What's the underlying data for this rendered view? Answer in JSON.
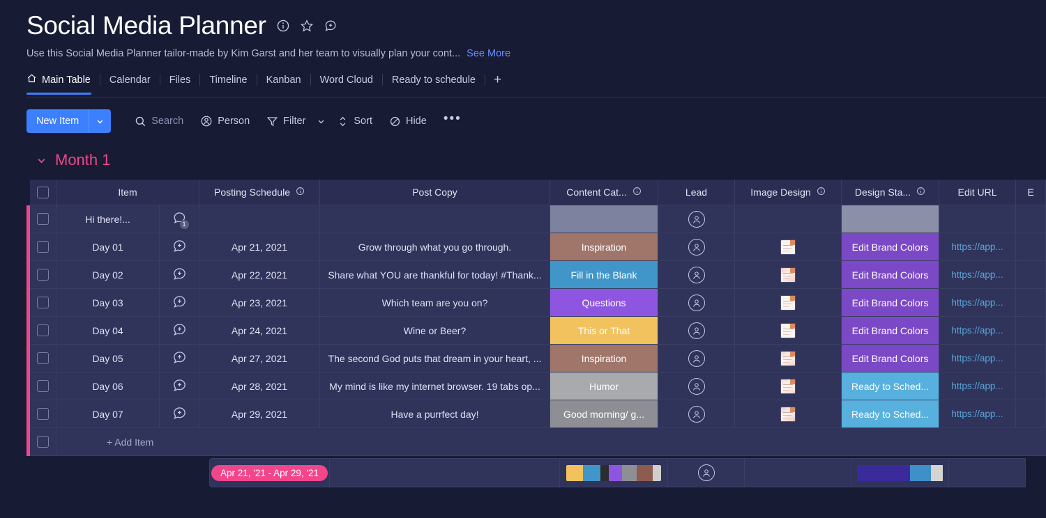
{
  "header": {
    "title": "Social Media Planner",
    "description": "Use this Social Media Planner tailor-made by Kim Garst and her team to visually plan your cont...",
    "see_more": "See More",
    "icons": [
      "info-icon",
      "star-icon",
      "add-comment-icon"
    ]
  },
  "tabs": [
    {
      "label": "Main Table",
      "icon": "home-icon",
      "active": true
    },
    {
      "label": "Calendar",
      "active": false
    },
    {
      "label": "Files",
      "active": false
    },
    {
      "label": "Timeline",
      "active": false
    },
    {
      "label": "Kanban",
      "active": false
    },
    {
      "label": "Word Cloud",
      "active": false
    },
    {
      "label": "Ready to schedule",
      "active": false
    }
  ],
  "tab_add": "+",
  "toolbar": {
    "new_item": "New Item",
    "search": "Search",
    "person": "Person",
    "filter": "Filter",
    "sort": "Sort",
    "hide": "Hide",
    "more": "•••"
  },
  "group": {
    "name": "Month 1",
    "accent": "#f2468b"
  },
  "columns": [
    {
      "label": "Item",
      "info": false
    },
    {
      "label": "Posting Schedule",
      "info": true
    },
    {
      "label": "Post Copy",
      "info": false
    },
    {
      "label": "Content Cat...",
      "info": true
    },
    {
      "label": "Lead",
      "info": false
    },
    {
      "label": "Image Design",
      "info": true
    },
    {
      "label": "Design Sta...",
      "info": true
    },
    {
      "label": "Edit URL",
      "info": false
    },
    {
      "label": "E",
      "info": false
    }
  ],
  "rows": [
    {
      "item": "Hi there!...",
      "chat": "1",
      "schedule": "",
      "copy": "",
      "category": "",
      "category_color": "#7d839e",
      "image": false,
      "status": "",
      "status_color": "#8b90a8",
      "url": ""
    },
    {
      "item": "Day 01",
      "chat": "+",
      "schedule": "Apr 21, 2021",
      "copy": "Grow through what you go through.",
      "category": "Inspiration",
      "category_color": "#a0756a",
      "image": true,
      "image_tone": "#f3efec",
      "status": "Edit Brand Colors",
      "status_color": "#7b49c6",
      "url": "https://app..."
    },
    {
      "item": "Day 02",
      "chat": "+",
      "schedule": "Apr 22, 2021",
      "copy": "Share what YOU are thankful for today! #Thank...",
      "category": "Fill in the Blank",
      "category_color": "#4096c8",
      "image": true,
      "image_tone": "#f0c9c2",
      "status": "Edit Brand Colors",
      "status_color": "#7b49c6",
      "url": "https://app..."
    },
    {
      "item": "Day 03",
      "chat": "+",
      "schedule": "Apr 23, 2021",
      "copy": "Which team are you on?",
      "category": "Questions",
      "category_color": "#8e56e0",
      "image": true,
      "image_tone": "#f6f1ec",
      "status": "Edit Brand Colors",
      "status_color": "#7b49c6",
      "url": "https://app..."
    },
    {
      "item": "Day 04",
      "chat": "+",
      "schedule": "Apr 24, 2021",
      "copy": "Wine or Beer?",
      "category": "This or That",
      "category_color": "#f1c25e",
      "image": true,
      "image_tone": "#f7f3f0",
      "status": "Edit Brand Colors",
      "status_color": "#7b49c6",
      "url": "https://app..."
    },
    {
      "item": "Day 05",
      "chat": "+",
      "schedule": "Apr 27, 2021",
      "copy": "The second God puts that dream in your heart, ...",
      "category": "Inspiration",
      "category_color": "#a0756a",
      "image": true,
      "image_tone": "#efd2cd",
      "status": "Edit Brand Colors",
      "status_color": "#7b49c6",
      "url": "https://app..."
    },
    {
      "item": "Day 06",
      "chat": "+",
      "schedule": "Apr 28, 2021",
      "copy": "My mind is like my internet browser. 19 tabs op...",
      "category": "Humor",
      "category_color": "#a9aaad",
      "image": true,
      "image_tone": "#f3d9ca",
      "status": "Ready to Sched...",
      "status_color": "#57b0dd",
      "url": "https://app..."
    },
    {
      "item": "Day 07",
      "chat": "+",
      "schedule": "Apr 29, 2021",
      "copy": "Have a purrfect day!",
      "category": "Good morning/ g...",
      "category_color": "#8d8f95",
      "image": true,
      "image_tone": "#e9c8c1",
      "status": "Ready to Sched...",
      "status_color": "#57b0dd",
      "url": "https://app..."
    }
  ],
  "add_item": "+ Add Item",
  "summary": {
    "date_range": "Apr 21, '21 - Apr 29, '21",
    "category_bar": [
      {
        "color": "#f1c25e",
        "width": 18
      },
      {
        "color": "#4096c8",
        "width": 18
      },
      {
        "color": "#2b2b30",
        "width": 9
      },
      {
        "color": "#8e56e0",
        "width": 14
      },
      {
        "color": "#8d8f95",
        "width": 15
      },
      {
        "color": "#8d5c4c",
        "width": 17
      },
      {
        "color": "#cfcfcf",
        "width": 9
      }
    ],
    "status_bar": [
      {
        "color": "#3b2a9c",
        "width": 62
      },
      {
        "color": "#3f8fc9",
        "width": 24
      },
      {
        "color": "#d4d4d4",
        "width": 14
      }
    ]
  }
}
